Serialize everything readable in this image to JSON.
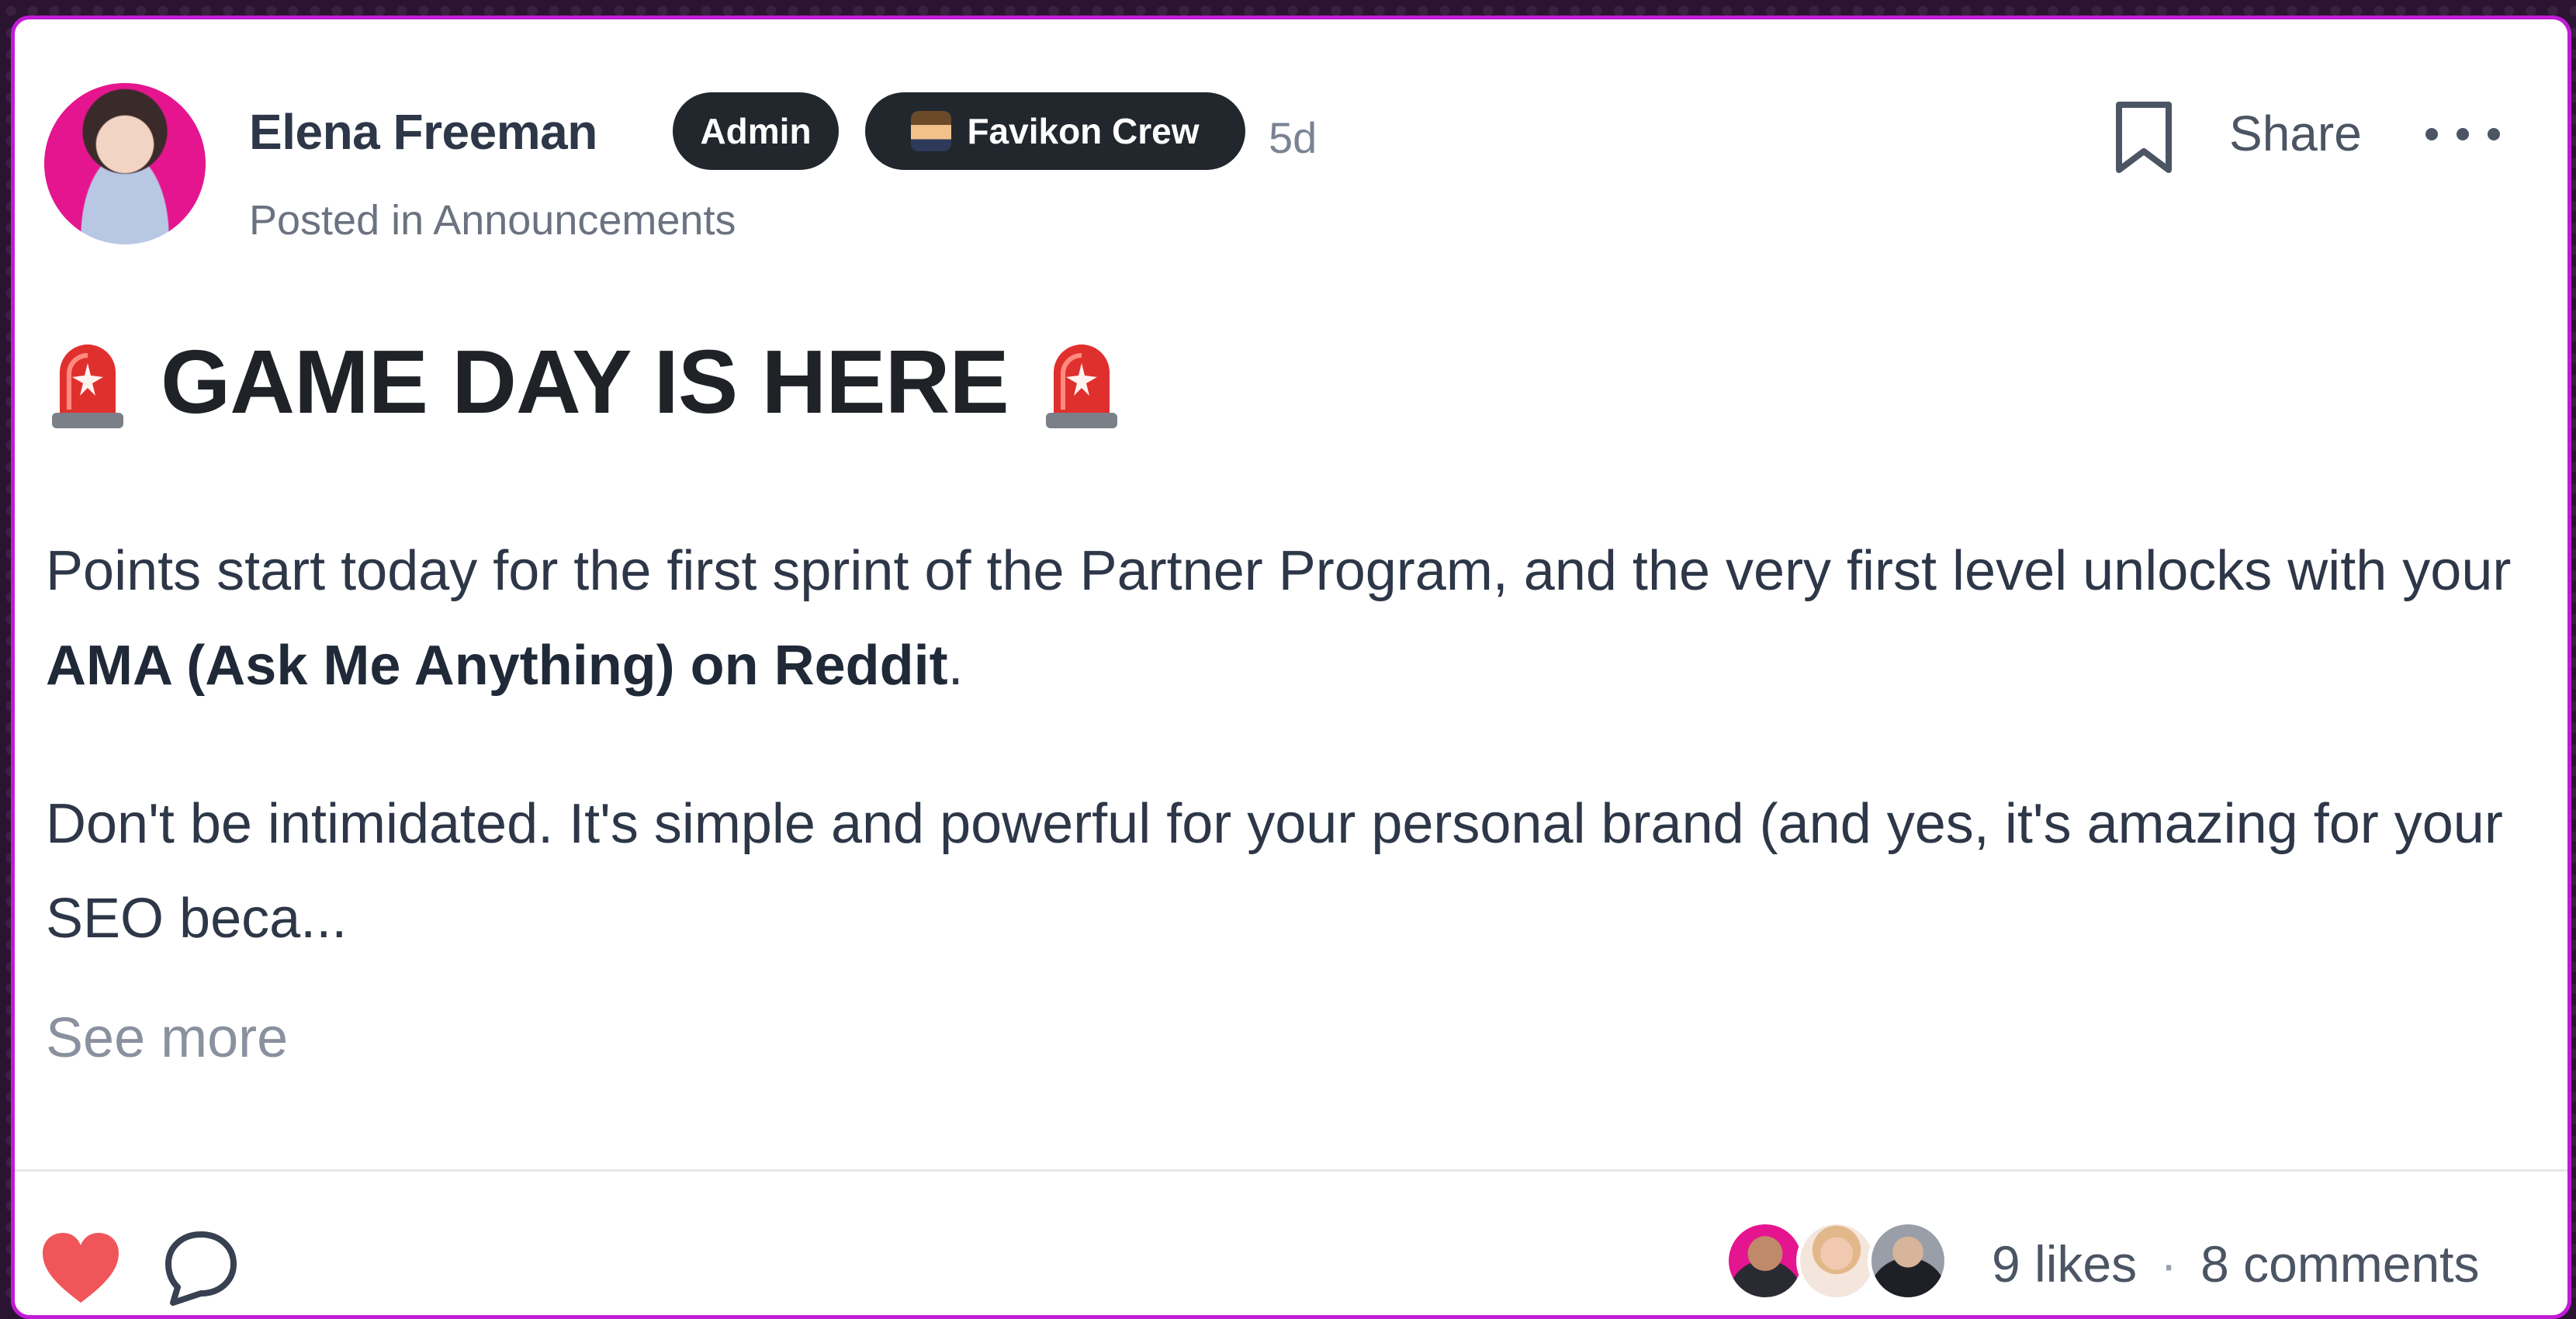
{
  "post": {
    "author": "Elena Freeman",
    "badges": {
      "admin": "Admin",
      "crew": "Favikon Crew"
    },
    "age": "5d",
    "posted_in_prefix": "Posted in ",
    "posted_in_space": "Announcements",
    "actions": {
      "share": "Share"
    },
    "headline": "GAME DAY IS HERE",
    "paragraph1": {
      "text": "Points start today for the first sprint of the Partner Program, and the very first level unlocks with your ",
      "bold": "AMA (Ask Me Anything) on Reddit",
      "end": "."
    },
    "paragraph2": "Don't be intimidated. It's simple and powerful for your personal brand (and yes, it's amazing for your SEO beca...",
    "see_more": "See more"
  },
  "footer": {
    "likes": "9 likes",
    "separator": "·",
    "comments": "8 comments"
  },
  "icons": [
    "siren-icon",
    "bookmark-icon",
    "more-icon",
    "heart-icon",
    "comment-icon"
  ],
  "colors": {
    "accent": "#c21bd6",
    "heart": "#f0555a",
    "badge_bg": "#22272e"
  }
}
